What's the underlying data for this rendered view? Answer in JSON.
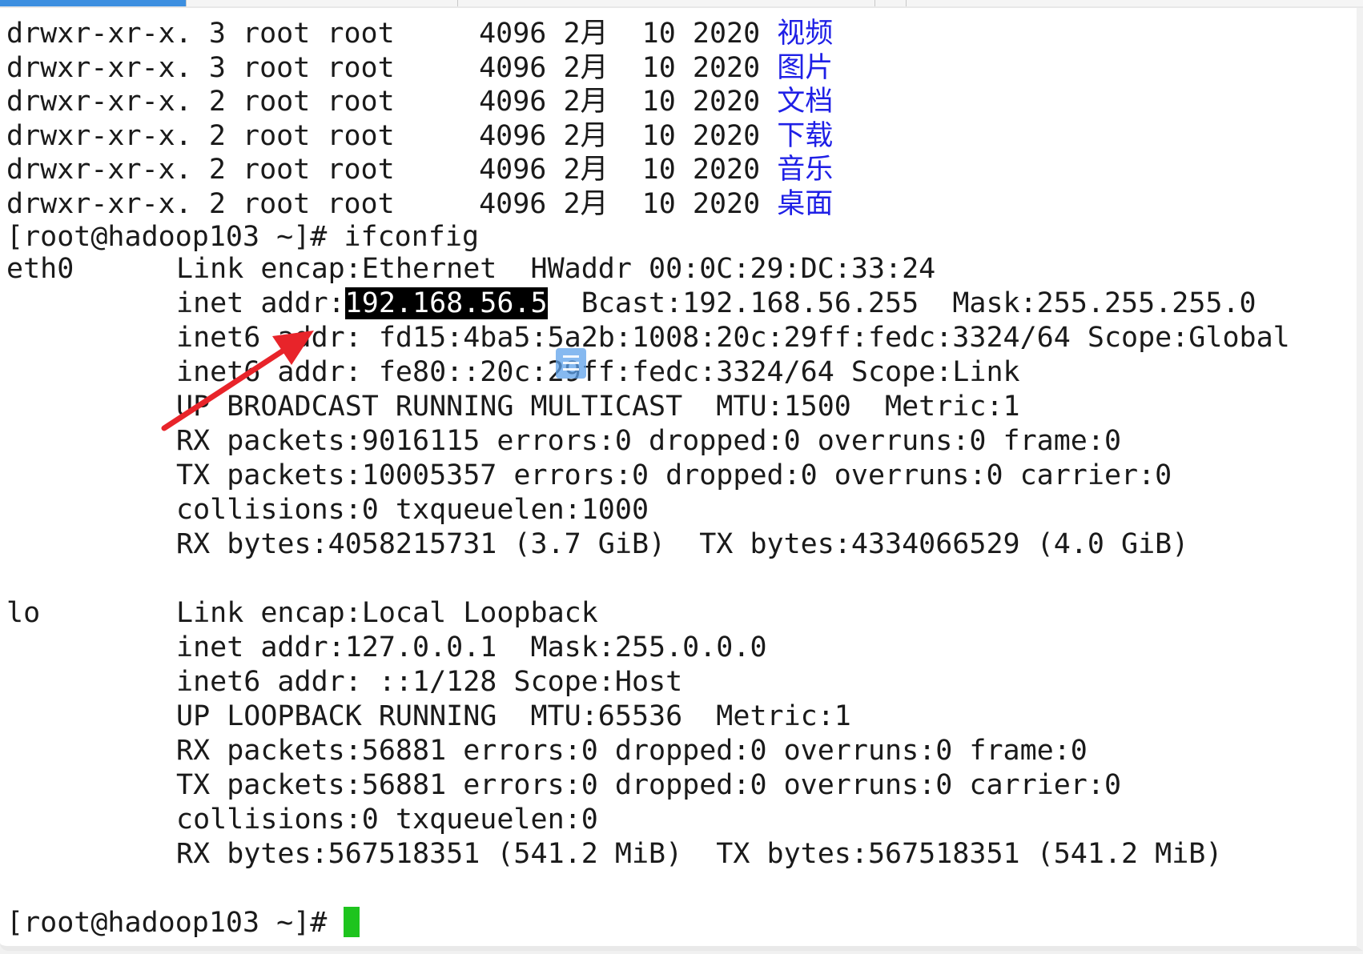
{
  "terminal": {
    "ls_rows": [
      {
        "perms": "drwxr-xr-x.",
        "links": "3",
        "owner": "root",
        "group": "root",
        "size": "4096",
        "month": "2月",
        "day": "10",
        "year": "2020",
        "name": "视频"
      },
      {
        "perms": "drwxr-xr-x.",
        "links": "3",
        "owner": "root",
        "group": "root",
        "size": "4096",
        "month": "2月",
        "day": "10",
        "year": "2020",
        "name": "图片"
      },
      {
        "perms": "drwxr-xr-x.",
        "links": "2",
        "owner": "root",
        "group": "root",
        "size": "4096",
        "month": "2月",
        "day": "10",
        "year": "2020",
        "name": "文档"
      },
      {
        "perms": "drwxr-xr-x.",
        "links": "2",
        "owner": "root",
        "group": "root",
        "size": "4096",
        "month": "2月",
        "day": "10",
        "year": "2020",
        "name": "下载"
      },
      {
        "perms": "drwxr-xr-x.",
        "links": "2",
        "owner": "root",
        "group": "root",
        "size": "4096",
        "month": "2月",
        "day": "10",
        "year": "2020",
        "name": "音乐"
      },
      {
        "perms": "drwxr-xr-x.",
        "links": "2",
        "owner": "root",
        "group": "root",
        "size": "4096",
        "month": "2月",
        "day": "10",
        "year": "2020",
        "name": "桌面"
      }
    ],
    "prompt": "[root@hadoop103 ~]#",
    "command": "ifconfig",
    "eth0": {
      "iface": "eth0",
      "link": "Link encap:Ethernet  HWaddr 00:0C:29:DC:33:24",
      "inet_prefix": "inet addr:",
      "inet_addr": "192.168.56.5",
      "inet_rest": "  Bcast:192.168.56.255  Mask:255.255.255.0",
      "inet6_global": "inet6 addr: fd15:4ba5:5a2b:1008:20c:29ff:fedc:3324/64 Scope:Global",
      "inet6_link": "inet6 addr: fe80::20c:29ff:fedc:3324/64 Scope:Link",
      "flags": "UP BROADCAST RUNNING MULTICAST  MTU:1500  Metric:1",
      "rx_packets": "RX packets:9016115 errors:0 dropped:0 overruns:0 frame:0",
      "tx_packets": "TX packets:10005357 errors:0 dropped:0 overruns:0 carrier:0",
      "collisions": "collisions:0 txqueuelen:1000",
      "bytes": "RX bytes:4058215731 (3.7 GiB)  TX bytes:4334066529 (4.0 GiB)"
    },
    "lo": {
      "iface": "lo",
      "link": "Link encap:Local Loopback",
      "inet": "inet addr:127.0.0.1  Mask:255.0.0.0",
      "inet6": "inet6 addr: ::1/128 Scope:Host",
      "flags": "UP LOOPBACK RUNNING  MTU:65536  Metric:1",
      "rx_packets": "RX packets:56881 errors:0 dropped:0 overruns:0 frame:0",
      "tx_packets": "TX packets:56881 errors:0 dropped:0 overruns:0 carrier:0",
      "collisions": "collisions:0 txqueuelen:0",
      "bytes": "RX bytes:567518351 (541.2 MiB)  TX bytes:567518351 (541.2 MiB)"
    }
  },
  "colors": {
    "dir_name": "#1f20e6",
    "selection_bg": "#000000",
    "cursor": "#1ec41e",
    "arrow": "#e8242a",
    "active_tab": "#3d8fe0"
  },
  "icons": {
    "annotation": "red-arrow-icon",
    "floating": "floating-note-icon"
  }
}
